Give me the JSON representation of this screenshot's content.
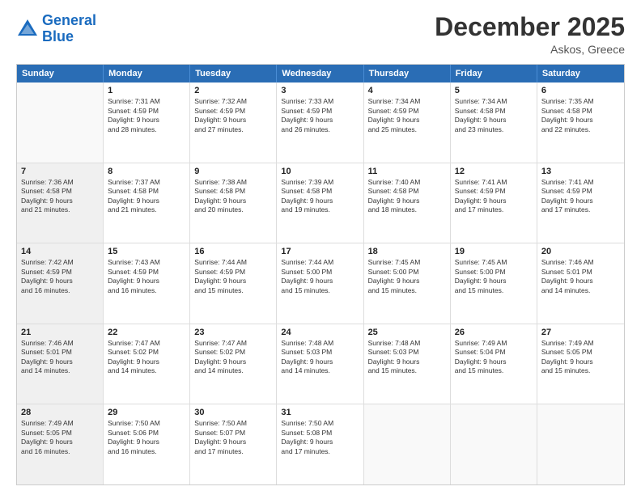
{
  "header": {
    "logo_line1": "General",
    "logo_line2": "Blue",
    "title": "December 2025",
    "location": "Askos, Greece"
  },
  "calendar": {
    "days_of_week": [
      "Sunday",
      "Monday",
      "Tuesday",
      "Wednesday",
      "Thursday",
      "Friday",
      "Saturday"
    ],
    "weeks": [
      [
        {
          "day": "",
          "info": "",
          "empty": true
        },
        {
          "day": "1",
          "info": "Sunrise: 7:31 AM\nSunset: 4:59 PM\nDaylight: 9 hours\nand 28 minutes.",
          "shaded": false
        },
        {
          "day": "2",
          "info": "Sunrise: 7:32 AM\nSunset: 4:59 PM\nDaylight: 9 hours\nand 27 minutes.",
          "shaded": false
        },
        {
          "day": "3",
          "info": "Sunrise: 7:33 AM\nSunset: 4:59 PM\nDaylight: 9 hours\nand 26 minutes.",
          "shaded": false
        },
        {
          "day": "4",
          "info": "Sunrise: 7:34 AM\nSunset: 4:59 PM\nDaylight: 9 hours\nand 25 minutes.",
          "shaded": false
        },
        {
          "day": "5",
          "info": "Sunrise: 7:34 AM\nSunset: 4:58 PM\nDaylight: 9 hours\nand 23 minutes.",
          "shaded": false
        },
        {
          "day": "6",
          "info": "Sunrise: 7:35 AM\nSunset: 4:58 PM\nDaylight: 9 hours\nand 22 minutes.",
          "shaded": false
        }
      ],
      [
        {
          "day": "7",
          "info": "Sunrise: 7:36 AM\nSunset: 4:58 PM\nDaylight: 9 hours\nand 21 minutes.",
          "shaded": true
        },
        {
          "day": "8",
          "info": "Sunrise: 7:37 AM\nSunset: 4:58 PM\nDaylight: 9 hours\nand 21 minutes.",
          "shaded": false
        },
        {
          "day": "9",
          "info": "Sunrise: 7:38 AM\nSunset: 4:58 PM\nDaylight: 9 hours\nand 20 minutes.",
          "shaded": false
        },
        {
          "day": "10",
          "info": "Sunrise: 7:39 AM\nSunset: 4:58 PM\nDaylight: 9 hours\nand 19 minutes.",
          "shaded": false
        },
        {
          "day": "11",
          "info": "Sunrise: 7:40 AM\nSunset: 4:58 PM\nDaylight: 9 hours\nand 18 minutes.",
          "shaded": false
        },
        {
          "day": "12",
          "info": "Sunrise: 7:41 AM\nSunset: 4:59 PM\nDaylight: 9 hours\nand 17 minutes.",
          "shaded": false
        },
        {
          "day": "13",
          "info": "Sunrise: 7:41 AM\nSunset: 4:59 PM\nDaylight: 9 hours\nand 17 minutes.",
          "shaded": false
        }
      ],
      [
        {
          "day": "14",
          "info": "Sunrise: 7:42 AM\nSunset: 4:59 PM\nDaylight: 9 hours\nand 16 minutes.",
          "shaded": true
        },
        {
          "day": "15",
          "info": "Sunrise: 7:43 AM\nSunset: 4:59 PM\nDaylight: 9 hours\nand 16 minutes.",
          "shaded": false
        },
        {
          "day": "16",
          "info": "Sunrise: 7:44 AM\nSunset: 4:59 PM\nDaylight: 9 hours\nand 15 minutes.",
          "shaded": false
        },
        {
          "day": "17",
          "info": "Sunrise: 7:44 AM\nSunset: 5:00 PM\nDaylight: 9 hours\nand 15 minutes.",
          "shaded": false
        },
        {
          "day": "18",
          "info": "Sunrise: 7:45 AM\nSunset: 5:00 PM\nDaylight: 9 hours\nand 15 minutes.",
          "shaded": false
        },
        {
          "day": "19",
          "info": "Sunrise: 7:45 AM\nSunset: 5:00 PM\nDaylight: 9 hours\nand 15 minutes.",
          "shaded": false
        },
        {
          "day": "20",
          "info": "Sunrise: 7:46 AM\nSunset: 5:01 PM\nDaylight: 9 hours\nand 14 minutes.",
          "shaded": false
        }
      ],
      [
        {
          "day": "21",
          "info": "Sunrise: 7:46 AM\nSunset: 5:01 PM\nDaylight: 9 hours\nand 14 minutes.",
          "shaded": true
        },
        {
          "day": "22",
          "info": "Sunrise: 7:47 AM\nSunset: 5:02 PM\nDaylight: 9 hours\nand 14 minutes.",
          "shaded": false
        },
        {
          "day": "23",
          "info": "Sunrise: 7:47 AM\nSunset: 5:02 PM\nDaylight: 9 hours\nand 14 minutes.",
          "shaded": false
        },
        {
          "day": "24",
          "info": "Sunrise: 7:48 AM\nSunset: 5:03 PM\nDaylight: 9 hours\nand 14 minutes.",
          "shaded": false
        },
        {
          "day": "25",
          "info": "Sunrise: 7:48 AM\nSunset: 5:03 PM\nDaylight: 9 hours\nand 15 minutes.",
          "shaded": false
        },
        {
          "day": "26",
          "info": "Sunrise: 7:49 AM\nSunset: 5:04 PM\nDaylight: 9 hours\nand 15 minutes.",
          "shaded": false
        },
        {
          "day": "27",
          "info": "Sunrise: 7:49 AM\nSunset: 5:05 PM\nDaylight: 9 hours\nand 15 minutes.",
          "shaded": false
        }
      ],
      [
        {
          "day": "28",
          "info": "Sunrise: 7:49 AM\nSunset: 5:05 PM\nDaylight: 9 hours\nand 16 minutes.",
          "shaded": true
        },
        {
          "day": "29",
          "info": "Sunrise: 7:50 AM\nSunset: 5:06 PM\nDaylight: 9 hours\nand 16 minutes.",
          "shaded": false
        },
        {
          "day": "30",
          "info": "Sunrise: 7:50 AM\nSunset: 5:07 PM\nDaylight: 9 hours\nand 17 minutes.",
          "shaded": false
        },
        {
          "day": "31",
          "info": "Sunrise: 7:50 AM\nSunset: 5:08 PM\nDaylight: 9 hours\nand 17 minutes.",
          "shaded": false
        },
        {
          "day": "",
          "info": "",
          "empty": true
        },
        {
          "day": "",
          "info": "",
          "empty": true
        },
        {
          "day": "",
          "info": "",
          "empty": true
        }
      ]
    ]
  }
}
